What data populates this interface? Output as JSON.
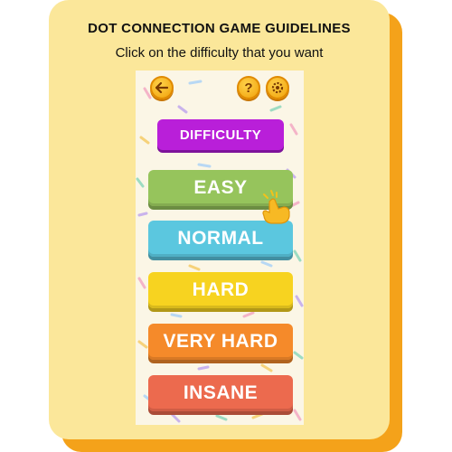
{
  "guide": {
    "title": "DOT CONNECTION GAME GUIDELINES",
    "subtitle": "Click on the difficulty that you want"
  },
  "topbar": {
    "back_icon": "arrow-left-icon",
    "help_icon": "question-mark-icon",
    "settings_icon": "gear-icon"
  },
  "difficulty_label": "DIFFICULTY",
  "levels": [
    {
      "label": "EASY",
      "color": "#96c45c"
    },
    {
      "label": "NORMAL",
      "color": "#5bc7df"
    },
    {
      "label": "HARD",
      "color": "#f7d320"
    },
    {
      "label": "VERY HARD",
      "color": "#f58a2a"
    },
    {
      "label": "INSANE",
      "color": "#ec6a4e"
    }
  ],
  "colors": {
    "card_bg": "#fbe79a",
    "card_shadow": "#f4a21a",
    "phone_bg": "#fbf6e6",
    "difficulty_bg": "#b91fd9"
  },
  "pointer_icon": "pointing-hand-icon"
}
